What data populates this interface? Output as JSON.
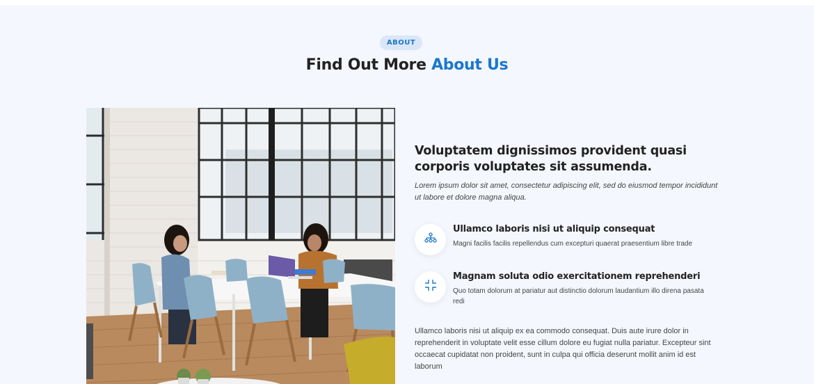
{
  "section": {
    "badge": "ABOUT",
    "title_prefix": "Find Out More ",
    "title_accent": "About Us"
  },
  "about": {
    "heading": "Voluptatem dignissimos provident quasi corporis voluptates sit assumenda.",
    "intro": "Lorem ipsum dolor sit amet, consectetur adipiscing elit, sed do eiusmod tempor incididunt ut labore et dolore magna aliqua.",
    "features": [
      {
        "icon": "diagram-icon",
        "title": "Ullamco laboris nisi ut aliquip consequat",
        "text": "Magni facilis facilis repellendus cum excepturi quaerat praesentium libre trade"
      },
      {
        "icon": "fullscreen-exit-icon",
        "title": "Magnam soluta odio exercitationem reprehenderi",
        "text": "Quo totam dolorum at pariatur aut distinctio dolorum laudantium illo direna pasata redi"
      }
    ],
    "outro": "Ullamco laboris nisi ut aliquip ex ea commodo consequat. Duis aute irure dolor in reprehenderit in voluptate velit esse cillum dolore eu fugiat nulla pariatur. Excepteur sint occaecat cupidatat non proident, sunt in culpa qui officia deserunt mollit anim id est laborum"
  },
  "colors": {
    "accent": "#1977cc",
    "section_bg": "#f4f7fd",
    "badge_bg": "#dbe6f8",
    "heading": "#222222"
  }
}
